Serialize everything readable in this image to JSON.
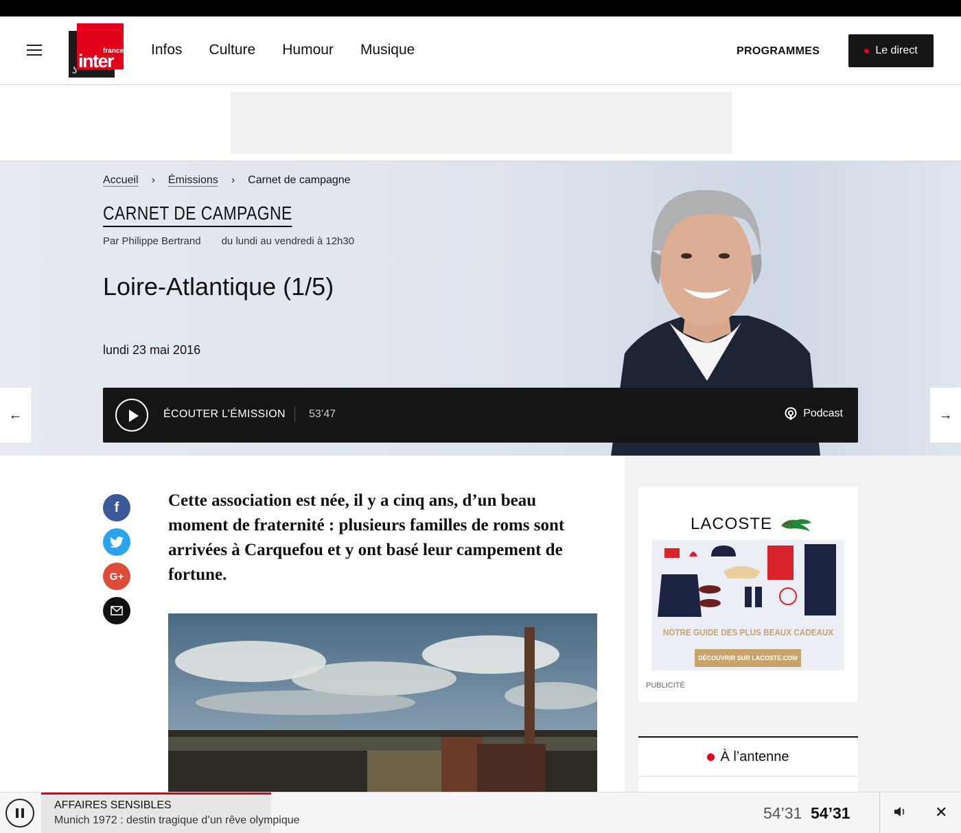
{
  "header": {
    "logo_small": "france",
    "logo_big": "inter",
    "nav": [
      "Infos",
      "Culture",
      "Humour",
      "Musique"
    ],
    "programmes": "PROGRAMMES",
    "direct": "Le direct"
  },
  "breadcrumb": [
    "Accueil",
    "Émissions",
    "Carnet de campagne"
  ],
  "show": {
    "title": "CARNET DE CAMPAGNE",
    "author": "Par Philippe Bertrand",
    "schedule": "du lundi au vendredi à 12h30",
    "episode": "Loire-Atlantique (1/5)",
    "date": "lundi 23 mai 2016"
  },
  "player": {
    "listen": "ÉCOUTER L’ÉMISSION",
    "duration": "53’47",
    "podcast": "Podcast"
  },
  "article": {
    "lead": "Cette association est née, il y a cinq ans, d’un beau moment de fraternité : plusieurs familles de roms sont arrivées à Carquefou et y ont basé leur campement de fortune."
  },
  "ad": {
    "brand": "LACOSTE",
    "tagline": "NOTRE GUIDE DES PLUS BEAUX CADEAUX",
    "cta": "DÉCOUVRIR SUR LACOSTE.COM",
    "label": "PUBLICITÉ"
  },
  "antenne": "À l’antenne",
  "bottom_player": {
    "show": "AFFAIRES SENSIBLES",
    "episode": "Munich 1972 : destin tragique d’un rêve olympique",
    "time_elapsed": "54’31",
    "time_total": "54’31"
  },
  "colors": {
    "accent": "#e2001a",
    "dark": "#151515"
  }
}
